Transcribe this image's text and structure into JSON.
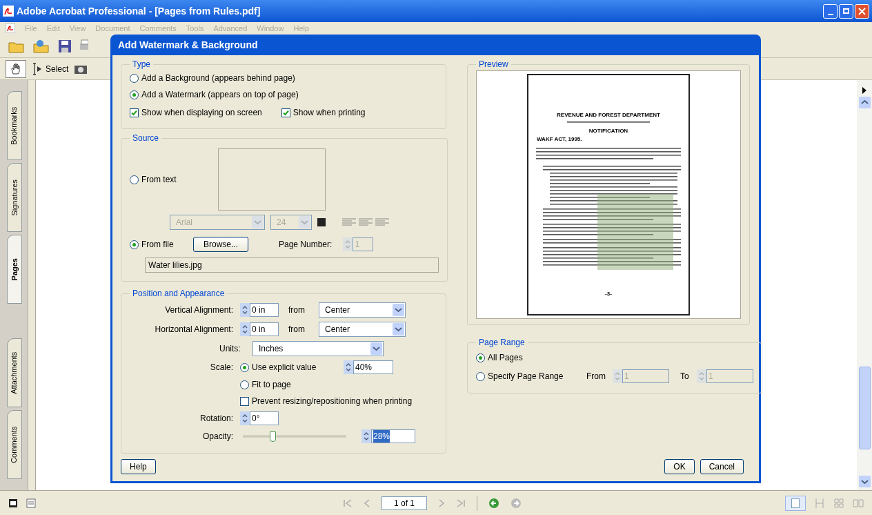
{
  "window": {
    "title": "Adobe Acrobat Professional - [Pages from Rules.pdf]"
  },
  "menu": [
    {
      "label": "File",
      "disabled": true
    },
    {
      "label": "Edit",
      "disabled": true
    },
    {
      "label": "View",
      "disabled": true
    },
    {
      "label": "Document",
      "disabled": true
    },
    {
      "label": "Comments",
      "disabled": true
    },
    {
      "label": "Tools",
      "disabled": true
    },
    {
      "label": "Advanced",
      "disabled": true
    },
    {
      "label": "Window",
      "disabled": true
    },
    {
      "label": "Help",
      "disabled": true
    }
  ],
  "toolbar": {
    "select_label": "Select"
  },
  "nav_tabs": {
    "top": [
      {
        "label": "Bookmarks",
        "selected": false
      },
      {
        "label": "Signatures",
        "selected": false
      },
      {
        "label": "Pages",
        "selected": true
      }
    ],
    "bottom": [
      {
        "label": "Attachments",
        "selected": false
      },
      {
        "label": "Comments",
        "selected": false
      }
    ]
  },
  "dialog": {
    "title": "Add Watermark & Background",
    "type": {
      "legend": "Type",
      "options": [
        {
          "label": "Add a Background (appears behind page)",
          "selected": false
        },
        {
          "label": "Add a Watermark (appears on top of page)",
          "selected": true
        }
      ],
      "checks": [
        {
          "label": "Show when displaying on screen",
          "checked": true
        },
        {
          "label": "Show when printing",
          "checked": true
        }
      ]
    },
    "source": {
      "legend": "Source",
      "from_text": {
        "label": "From text",
        "selected": false,
        "disabled": true,
        "font": "Arial",
        "size": "24"
      },
      "from_file": {
        "label": "From file",
        "selected": true,
        "browse": "Browse...",
        "page_number_label": "Page Number:",
        "page_number": "1",
        "page_number_disabled": true,
        "file": "Water lilies.jpg"
      }
    },
    "position": {
      "legend": "Position and Appearance",
      "alignments": [
        {
          "label": "Vertical Alignment:",
          "value": "0 in",
          "from": "from",
          "anchor": "Center"
        },
        {
          "label": "Horizontal Alignment:",
          "value": "0 in",
          "from": "from",
          "anchor": "Center"
        }
      ],
      "units": {
        "label": "Units:",
        "value": "Inches"
      },
      "scale": {
        "label": "Scale:",
        "options": [
          {
            "label": "Use explicit value",
            "selected": true
          },
          {
            "label": "Fit to page",
            "selected": false
          }
        ],
        "value": "40%"
      },
      "prevent": {
        "label": "Prevent resizing/repositioning when printing",
        "checked": false
      },
      "rotation": {
        "label": "Rotation:",
        "value": "0°"
      },
      "opacity": {
        "label": "Opacity:",
        "level": 0.28,
        "value": "28%"
      }
    },
    "preview": {
      "legend": "Preview",
      "heading": "REVENUE AND FOREST DEPARTMENT",
      "notification": "NOTIFICATION",
      "act": "WAKF ACT, 1995.",
      "page_label": "-3-"
    },
    "page_range": {
      "legend": "Page Range",
      "options": [
        {
          "label": "All Pages",
          "selected": true
        },
        {
          "label": "Specify Page Range",
          "selected": false
        }
      ],
      "from_label": "From",
      "from": "1",
      "to_label": "To",
      "to": "1",
      "disabled": true
    },
    "buttons": {
      "help": "Help",
      "ok": "OK",
      "cancel": "Cancel"
    }
  },
  "status": {
    "page": "1 of 1"
  }
}
